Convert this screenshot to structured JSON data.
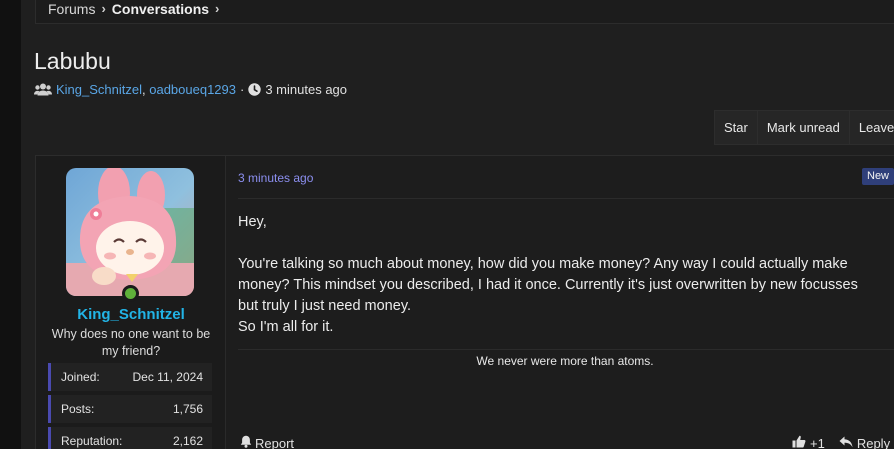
{
  "breadcrumb": {
    "items": [
      "Forums",
      "Conversations"
    ]
  },
  "thread": {
    "title": "Labubu",
    "participants": [
      "King_Schnitzel",
      "oadboueq1293"
    ],
    "separator": ", ",
    "dot": "·",
    "time": "3 minutes ago"
  },
  "actions": {
    "star": "Star",
    "mark_unread": "Mark unread",
    "leave": "Leave"
  },
  "user": {
    "name": "King_Schnitzel",
    "title": "Why does no one want to be my friend?",
    "online": true,
    "stats": [
      {
        "label": "Joined:",
        "value": "Dec 11, 2024"
      },
      {
        "label": "Posts:",
        "value": "1,756"
      },
      {
        "label": "Reputation:",
        "value": "2,162"
      }
    ]
  },
  "message": {
    "time": "3 minutes ago",
    "badge": "New",
    "greeting": "Hey,",
    "body": "You're talking so much about money, how did you make money? Any way I could actually make money? This mindset you described, I had it once. Currently it's just overwritten by new focusses but truly I just need money.",
    "closing": "So I'm all for it.",
    "signature": "We never were more than atoms."
  },
  "footer": {
    "report": "Report",
    "like_count": "+1",
    "reply": "Reply"
  },
  "colors": {
    "link": "#5aa6e6",
    "username": "#22b4e6",
    "timestamp": "#8c8ff0",
    "online": "#5fb03a",
    "badge": "#2f3f7a",
    "stat_accent": "#4a4ab0"
  },
  "icons": {
    "participants": "users-icon",
    "time": "clock-icon",
    "report": "bell-icon",
    "like": "thumbs-up-icon",
    "reply": "reply-icon"
  }
}
